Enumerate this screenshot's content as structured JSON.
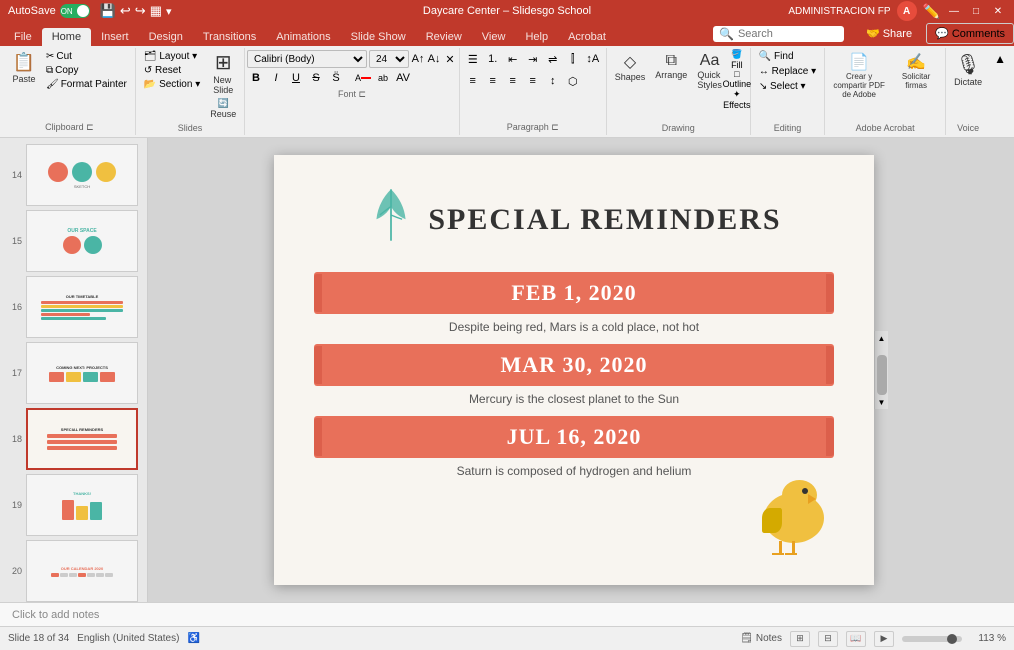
{
  "titlebar": {
    "autosave_label": "AutoSave",
    "autosave_state": "ON",
    "title": "Daycare Center – Slidesgo School",
    "admin_label": "ADMINISTRACION FP",
    "minimize": "—",
    "maximize": "□",
    "close": "✕"
  },
  "ribbon_tabs": [
    "File",
    "Home",
    "Insert",
    "Design",
    "Transitions",
    "Animations",
    "Slide Show",
    "Review",
    "View",
    "Help",
    "Acrobat"
  ],
  "active_tab": "Home",
  "toolbar": {
    "clipboard": {
      "label": "Clipboard",
      "paste": "Paste",
      "copy": "Copy",
      "cut": "Cut",
      "format_painter": "Format Painter"
    },
    "slides": {
      "label": "Slides",
      "new_slide": "New Slide",
      "reuse": "Reuse",
      "layout": "Layout",
      "reset": "Reset",
      "section": "Section"
    },
    "font": {
      "label": "Font",
      "font_name": "Calibri (Body)",
      "font_size": "24",
      "bold": "B",
      "italic": "I",
      "underline": "U",
      "strikethrough": "S"
    },
    "paragraph": {
      "label": "Paragraph",
      "bullets": "☰",
      "numbering": "1.",
      "indent_l": "←",
      "indent_r": "→",
      "align": "≡"
    },
    "drawing": {
      "label": "Drawing",
      "shapes": "Shapes",
      "arrange": "Arrange",
      "quick_styles": "Quick Styles",
      "fill": "Fill"
    },
    "editing": {
      "label": "Editing",
      "find": "Find",
      "replace": "Replace",
      "select": "Select"
    },
    "adobe": {
      "label": "Adobe Acrobat",
      "create_share": "Crear y compartir PDF de Adobe",
      "request_sig": "Solicitar firmas"
    },
    "voice": {
      "label": "Voice",
      "dictate": "Dictate"
    },
    "share": "Share",
    "comments": "Comments",
    "search_placeholder": "Search"
  },
  "slides": [
    {
      "number": "14",
      "active": false,
      "label": "Slide 14"
    },
    {
      "number": "15",
      "active": false,
      "label": "Slide 15"
    },
    {
      "number": "16",
      "active": false,
      "label": "Slide 16"
    },
    {
      "number": "17",
      "active": false,
      "label": "Slide 17"
    },
    {
      "number": "18",
      "active": true,
      "label": "Slide 18 - Special Reminders"
    },
    {
      "number": "19",
      "active": false,
      "label": "Slide 19"
    },
    {
      "number": "20",
      "active": false,
      "label": "Slide 20"
    }
  ],
  "slide": {
    "title": "SPECIAL REMINDERS",
    "dates": [
      {
        "date": "FEB 1, 2020",
        "desc": "Despite being red, Mars is a cold place, not hot"
      },
      {
        "date": "MAR 30, 2020",
        "desc": "Mercury is the closest planet to the Sun"
      },
      {
        "date": "JUL 16, 2020",
        "desc": "Saturn is composed of hydrogen and helium"
      }
    ]
  },
  "statusbar": {
    "slide_count": "Slide 18 of 34",
    "language": "English (United States)",
    "notes": "Click to add notes",
    "zoom": "113 %"
  }
}
